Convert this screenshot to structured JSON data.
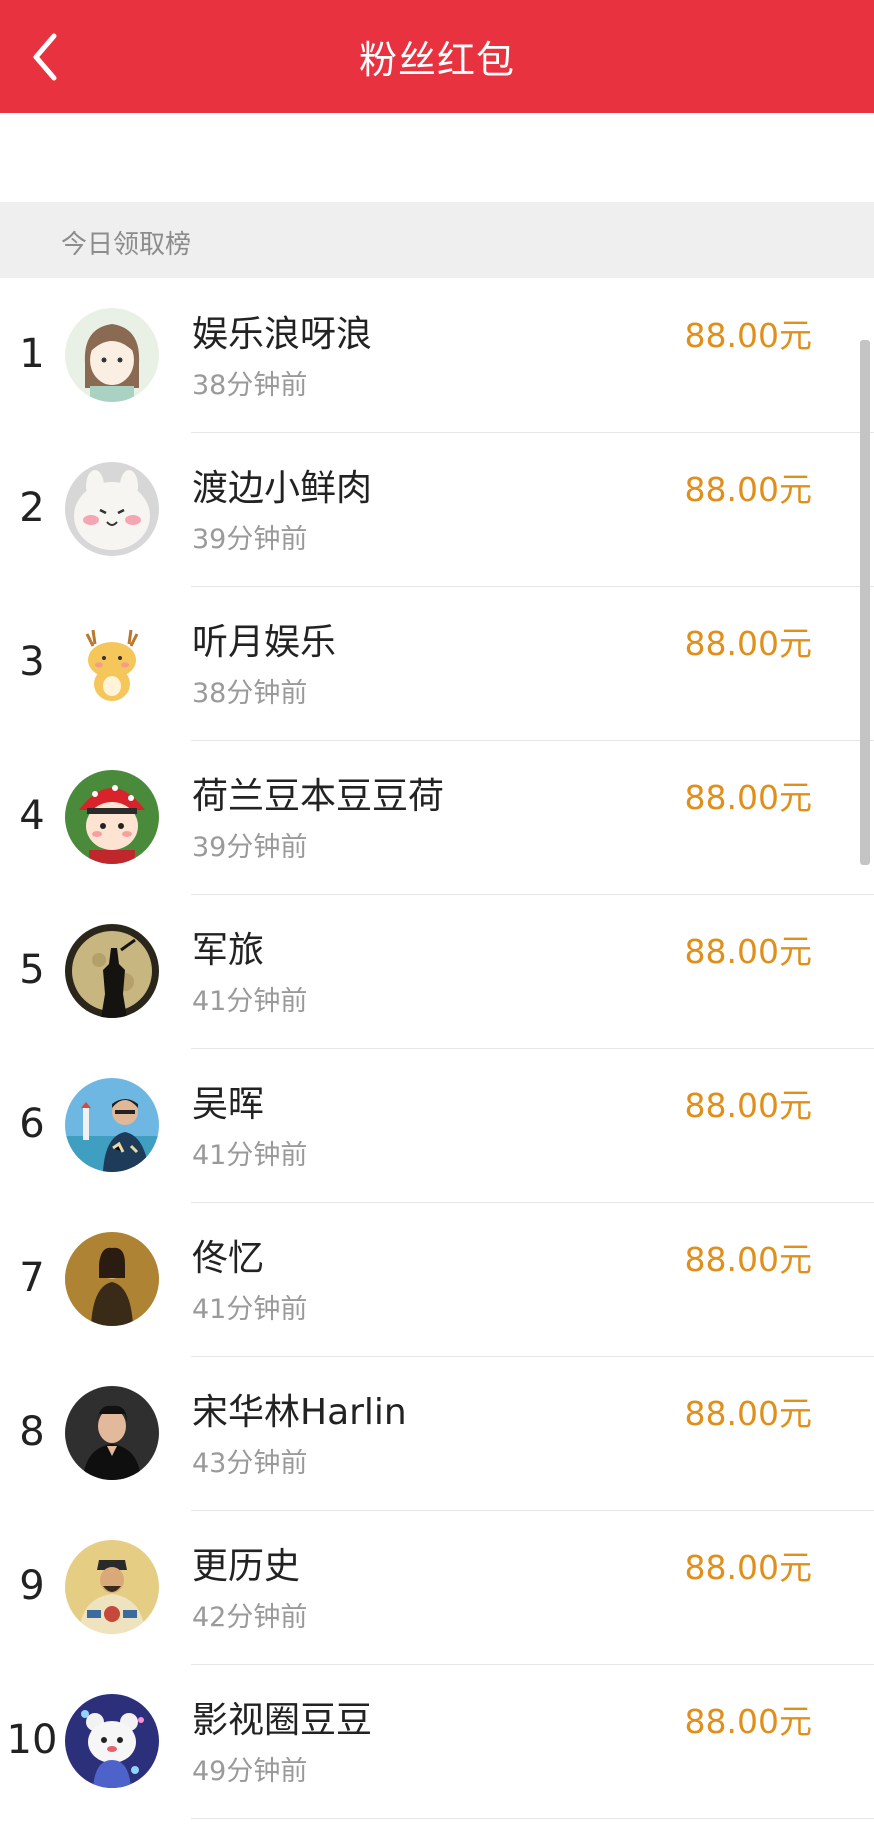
{
  "header": {
    "title": "粉丝红包",
    "back_icon": "chevron-left-icon"
  },
  "section": {
    "label": "今日领取榜"
  },
  "colors": {
    "header_bg": "#e8323f",
    "amount": "#e0901a"
  },
  "rows": [
    {
      "rank": "1",
      "name": "娱乐浪呀浪",
      "time": "38分钟前",
      "amount": "88.00元",
      "avatar": "cartoon-girl-avatar"
    },
    {
      "rank": "2",
      "name": "渡边小鲜肉",
      "time": "39分钟前",
      "amount": "88.00元",
      "avatar": "white-bunny-avatar"
    },
    {
      "rank": "3",
      "name": "听月娱乐",
      "time": "38分钟前",
      "amount": "88.00元",
      "avatar": "cartoon-deer-avatar"
    },
    {
      "rank": "4",
      "name": "荷兰豆本豆豆荷",
      "time": "39分钟前",
      "amount": "88.00元",
      "avatar": "cartoon-girl-red-hat-avatar"
    },
    {
      "rank": "5",
      "name": "军旅",
      "time": "41分钟前",
      "amount": "88.00元",
      "avatar": "soldier-silhouette-moon-avatar"
    },
    {
      "rank": "6",
      "name": "吴晖",
      "time": "41分钟前",
      "amount": "88.00元",
      "avatar": "man-seaside-lighthouse-avatar"
    },
    {
      "rank": "7",
      "name": "佟忆",
      "time": "41分钟前",
      "amount": "88.00元",
      "avatar": "vintage-portrait-avatar"
    },
    {
      "rank": "8",
      "name": "宋华林Harlin",
      "time": "43分钟前",
      "amount": "88.00元",
      "avatar": "man-dark-background-avatar"
    },
    {
      "rank": "9",
      "name": "更历史",
      "time": "42分钟前",
      "amount": "88.00元",
      "avatar": "ancient-emperor-portrait-avatar"
    },
    {
      "rank": "10",
      "name": "影视圈豆豆",
      "time": "49分钟前",
      "amount": "88.00元",
      "avatar": "cartoon-bear-blue-avatar"
    }
  ]
}
